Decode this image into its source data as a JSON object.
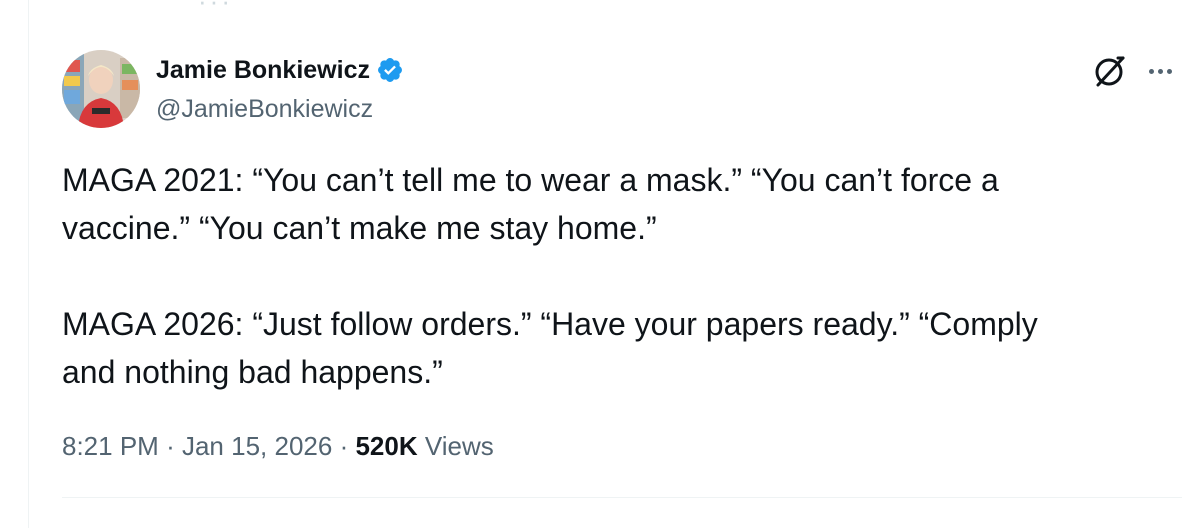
{
  "author": {
    "display_name": "Jamie Bonkiewicz",
    "handle": "@JamieBonkiewicz",
    "verified": true,
    "avatar_icon": "profile-photo"
  },
  "tweet": {
    "paragraphs": [
      [
        "MAGA 2021: “You can’t tell me to wear a mask.” “You can’t force a",
        "vaccine.” “You can’t make me stay home.”"
      ],
      [
        "MAGA 2026: “Just follow orders.” “Have your papers ready.” “Comply",
        "and nothing bad happens.”"
      ]
    ]
  },
  "meta": {
    "time": "8:21 PM",
    "separator": "·",
    "date": "Jan 15, 2026",
    "views_count": "520K",
    "views_label": "Views"
  },
  "icons": {
    "verified": "verified-badge-icon",
    "grok": "grok-icon",
    "more": "more-options-icon"
  },
  "colors": {
    "text_primary": "#0f1419",
    "text_secondary": "#536471",
    "verified_blue": "#1d9bf0",
    "border": "#eff3f4"
  }
}
